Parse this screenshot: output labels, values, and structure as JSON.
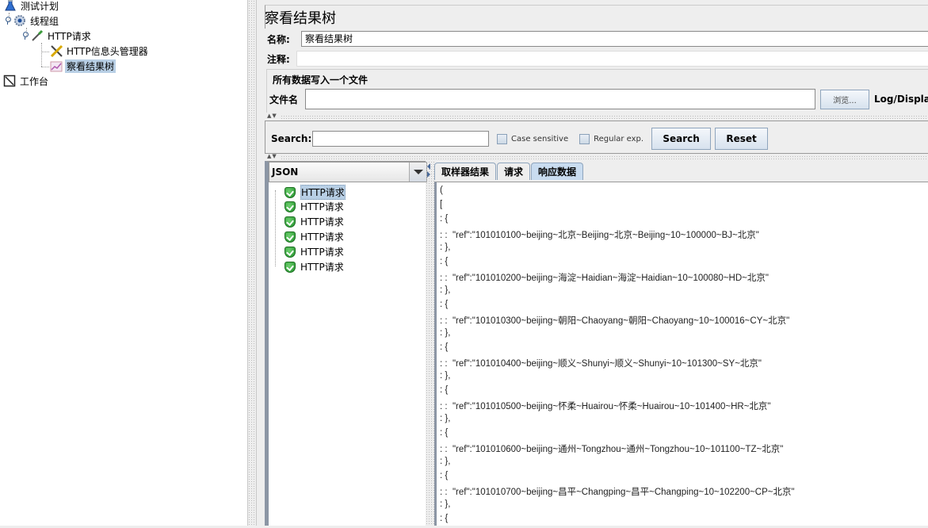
{
  "tree": {
    "items": [
      {
        "label": "测试计划",
        "icon": "test-plan-flask-icon"
      },
      {
        "label": "线程组",
        "icon": "thread-group-gear-icon"
      },
      {
        "label": "HTTP请求",
        "icon": "http-sampler-pipette-icon"
      },
      {
        "label": "HTTP信息头管理器",
        "icon": "header-manager-tools-icon"
      },
      {
        "label": "察看结果树",
        "icon": "results-tree-chart-icon",
        "selected": true
      },
      {
        "label": "工作台",
        "icon": "workbench-icon"
      }
    ]
  },
  "panel": {
    "title": "察看结果树",
    "name_label": "名称:",
    "name_value": "察看结果树",
    "comment_label": "注释:",
    "comment_value": "",
    "fieldset_legend": "所有数据写入一个文件",
    "filename_label": "文件名",
    "filename_value": "",
    "browse_button": "浏览...",
    "log_display_label": "Log/Display"
  },
  "search": {
    "label": "Search:",
    "value": "",
    "case_sensitive_label": "Case sensitive",
    "regex_label": "Regular exp.",
    "search_button": "Search",
    "reset_button": "Reset"
  },
  "results": {
    "renderer_selected": "JSON",
    "samples": [
      {
        "label": "HTTP请求",
        "status": "success",
        "selected": true
      },
      {
        "label": "HTTP请求",
        "status": "success"
      },
      {
        "label": "HTTP请求",
        "status": "success"
      },
      {
        "label": "HTTP请求",
        "status": "success"
      },
      {
        "label": "HTTP请求",
        "status": "success"
      },
      {
        "label": "HTTP请求",
        "status": "success"
      }
    ],
    "tabs": [
      {
        "label": "取样器结果"
      },
      {
        "label": "请求"
      },
      {
        "label": "响应数据",
        "active": true
      }
    ],
    "response_lines": [
      "(",
      "[",
      ": {",
      ": :  \"ref\":\"101010100~beijing~北京~Beijing~北京~Beijing~10~100000~BJ~北京\"",
      ": },",
      ": {",
      ": :  \"ref\":\"101010200~beijing~海淀~Haidian~海淀~Haidian~10~100080~HD~北京\"",
      ": },",
      ": {",
      ": :  \"ref\":\"101010300~beijing~朝阳~Chaoyang~朝阳~Chaoyang~10~100016~CY~北京\"",
      ": },",
      ": {",
      ": :  \"ref\":\"101010400~beijing~顺义~Shunyi~顺义~Shunyi~10~101300~SY~北京\"",
      ": },",
      ": {",
      ": :  \"ref\":\"101010500~beijing~怀柔~Huairou~怀柔~Huairou~10~101400~HR~北京\"",
      ": },",
      ": {",
      ": :  \"ref\":\"101010600~beijing~通州~Tongzhou~通州~Tongzhou~10~101100~TZ~北京\"",
      ": },",
      ": {",
      ": :  \"ref\":\"101010700~beijing~昌平~Changping~昌平~Changping~10~102200~CP~北京\"",
      ": },",
      ": {"
    ]
  }
}
